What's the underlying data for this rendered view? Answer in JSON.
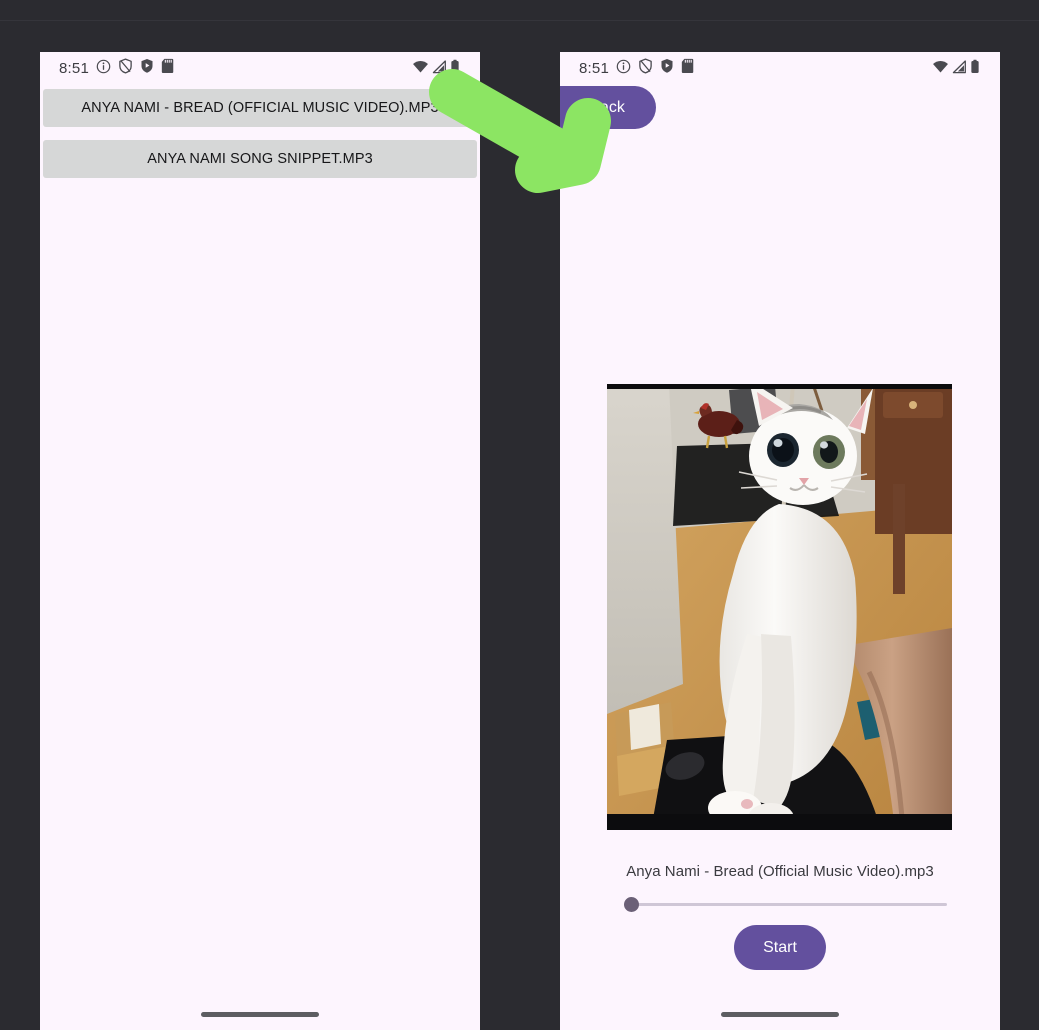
{
  "annotation": {
    "arrow_color": "#8ce563",
    "arrow_name": "green-pointer-arrow",
    "points_to": "back-button"
  },
  "theme": {
    "panel_background": "#fdf5fe",
    "chrome_background": "#2b2b30",
    "accent_purple": "#63509e",
    "list_item_background": "#d6d7d7",
    "slider_thumb": "#6b6077",
    "slider_track": "#cfc6d6",
    "gesture_bar": "#5d5d62"
  },
  "status_bar": {
    "clock": "8:51",
    "left_icons": [
      "info-circle-icon",
      "shield-outline-icon",
      "shield-play-icon",
      "sd-card-icon"
    ],
    "right_icons": [
      "wifi-icon",
      "cell-signal-icon",
      "battery-icon"
    ]
  },
  "left_screen": {
    "name": "file-picker-screen",
    "files": [
      {
        "label": "ANYA NAMI - BREAD (OFFICIAL MUSIC VIDEO).MP3"
      },
      {
        "label": "ANYA NAMI SONG SNIPPET.MP3"
      }
    ]
  },
  "right_screen": {
    "name": "player-screen",
    "back_label": "back",
    "artwork_alt": "white cat standing upright on a person's leg, wooden floor room with a hen in the background",
    "track_title": "Anya Nami - Bread (Official Music Video).mp3",
    "slider": {
      "value": 0,
      "min": 0,
      "max": 100
    },
    "start_label": "Start"
  }
}
